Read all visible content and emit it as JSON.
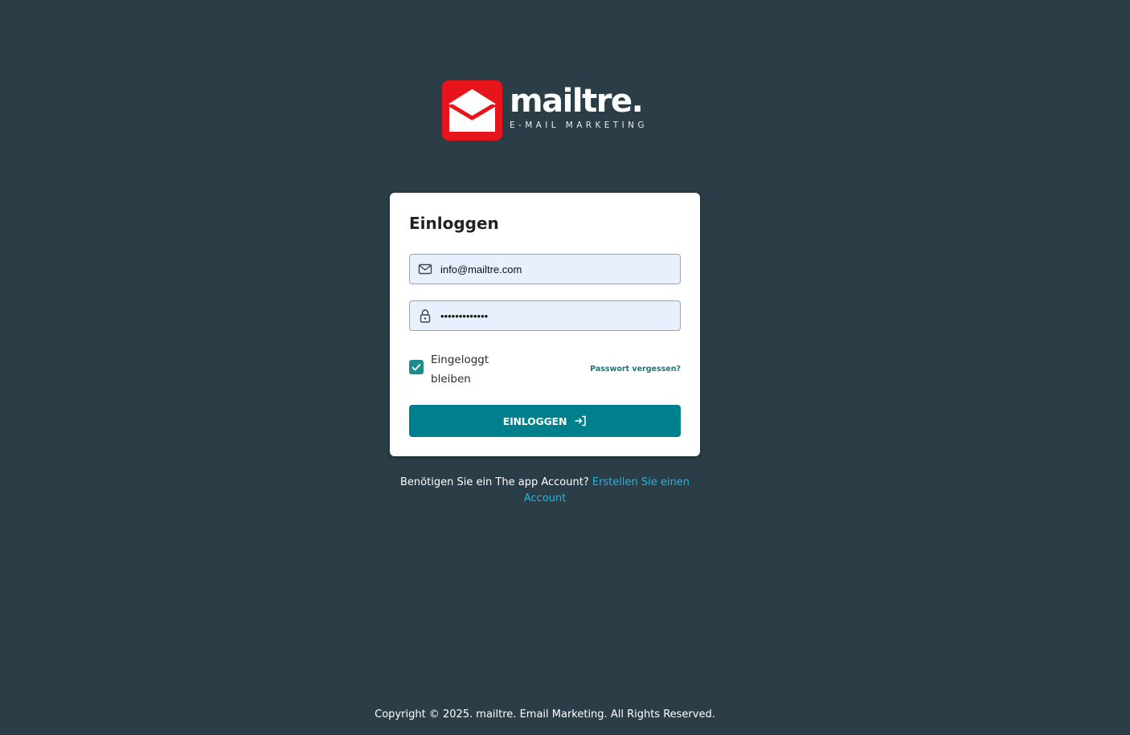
{
  "brand": {
    "name": "mailtre.",
    "tagline": "E-MAIL MARKETING",
    "logo_color": "#e8141c"
  },
  "login": {
    "title": "Einloggen",
    "email": {
      "value": "info@mailtre.com",
      "icon": "mail-icon"
    },
    "password": {
      "value": "•••••••••••••",
      "icon": "lock-icon"
    },
    "remember_me": {
      "label": "Eingeloggt bleiben",
      "checked": true
    },
    "forgot_password": "Passwort vergessen?",
    "submit_label": "EINLOGGEN",
    "submit_icon": "login-icon"
  },
  "signup": {
    "prompt": "Benötigen Sie ein The app Account?",
    "link_part1": "Erstellen Sie einen",
    "link_part2": "Account"
  },
  "footer": {
    "copyright": "Copyright © 2025. mailtre. Email Marketing. All Rights Reserved."
  },
  "colors": {
    "background": "#2b3d47",
    "accent": "#00808c",
    "link": "#1db8e0"
  }
}
